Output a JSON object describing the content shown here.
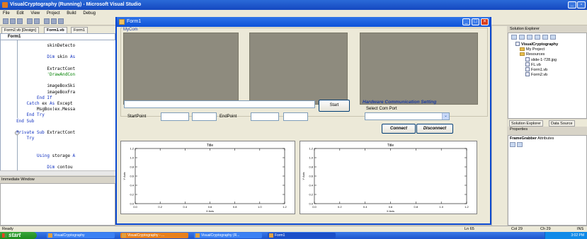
{
  "vs": {
    "title": "VisualCryptography (Running) - Microsoft Visual Studio",
    "menu": [
      "File",
      "Edit",
      "View",
      "Project",
      "Build",
      "Debug"
    ],
    "doc_tabs": [
      "Form2.vb [Design]",
      "Form1.vb",
      "Form1"
    ],
    "code_header": "Form1",
    "code_lines": [
      {
        "indent": "                 ",
        "parts": [
          {
            "t": "skinDetecto",
            "c": ""
          }
        ]
      },
      {
        "indent": "",
        "parts": [
          {
            "t": "",
            "c": ""
          }
        ]
      },
      {
        "indent": "                 ",
        "parts": [
          {
            "t": "Dim",
            "c": "kw"
          },
          {
            "t": " skin ",
            "c": ""
          },
          {
            "t": "As",
            "c": "kw"
          }
        ]
      },
      {
        "indent": "",
        "parts": [
          {
            "t": "",
            "c": ""
          }
        ]
      },
      {
        "indent": "                 ",
        "parts": [
          {
            "t": "ExtractCont",
            "c": ""
          }
        ]
      },
      {
        "indent": "                 ",
        "parts": [
          {
            "t": "'DrawAndCon",
            "c": "cm"
          }
        ]
      },
      {
        "indent": "",
        "parts": [
          {
            "t": "",
            "c": ""
          }
        ]
      },
      {
        "indent": "                 ",
        "parts": [
          {
            "t": "imageBoxSki",
            "c": ""
          }
        ]
      },
      {
        "indent": "                 ",
        "parts": [
          {
            "t": "imageBoxFra",
            "c": ""
          }
        ]
      },
      {
        "indent": "             ",
        "parts": [
          {
            "t": "End If",
            "c": "kw"
          }
        ]
      },
      {
        "indent": "         ",
        "parts": [
          {
            "t": "Catch",
            "c": "kw"
          },
          {
            "t": " ex ",
            "c": ""
          },
          {
            "t": "As",
            "c": "kw"
          },
          {
            "t": " Except",
            "c": ""
          }
        ]
      },
      {
        "indent": "             ",
        "parts": [
          {
            "t": "MsgBox(ex.Messa",
            "c": ""
          }
        ]
      },
      {
        "indent": "         ",
        "parts": [
          {
            "t": "End Try",
            "c": "kw"
          }
        ]
      },
      {
        "indent": "     ",
        "parts": [
          {
            "t": "End Sub",
            "c": "kw"
          }
        ]
      },
      {
        "indent": "",
        "parts": [
          {
            "t": "",
            "c": ""
          }
        ]
      },
      {
        "indent": "     ",
        "parts": [
          {
            "t": "Private Sub",
            "c": "kw"
          },
          {
            "t": " ExtractCont",
            "c": ""
          }
        ]
      },
      {
        "indent": "         ",
        "parts": [
          {
            "t": "Try",
            "c": "kw"
          }
        ]
      },
      {
        "indent": "",
        "parts": [
          {
            "t": "",
            "c": ""
          }
        ]
      },
      {
        "indent": "",
        "parts": [
          {
            "t": "",
            "c": ""
          }
        ]
      },
      {
        "indent": "             ",
        "parts": [
          {
            "t": "Using",
            "c": "kw"
          },
          {
            "t": " storage ",
            "c": ""
          },
          {
            "t": "A",
            "c": "kw"
          }
        ]
      },
      {
        "indent": "",
        "parts": [
          {
            "t": "",
            "c": ""
          }
        ]
      },
      {
        "indent": "                 ",
        "parts": [
          {
            "t": "Dim",
            "c": "kw"
          },
          {
            "t": " contou",
            "c": ""
          }
        ]
      }
    ],
    "immediate_window_title": "Immediate Window",
    "solution_explorer": {
      "title": "Solution Explorer",
      "items": [
        {
          "label": "VisualCryptography",
          "bold": true,
          "level": 1,
          "icon": "project-icon"
        },
        {
          "label": "My Project",
          "level": 2,
          "icon": "folder-icon"
        },
        {
          "label": "Resources",
          "level": 2,
          "icon": "folder-icon"
        },
        {
          "label": "slide-1-728.jpg",
          "level": 3,
          "icon": "image-file-icon"
        },
        {
          "label": "FL.vb",
          "level": 3,
          "icon": "file-icon"
        },
        {
          "label": "Form1.vb",
          "level": 3,
          "icon": "file-icon"
        },
        {
          "label": "Form2.vb",
          "level": 3,
          "icon": "file-icon"
        }
      ],
      "tabs": [
        "Solution Explorer",
        "Data Source"
      ]
    },
    "properties": {
      "title": "Properties",
      "object": "FrameGrabber",
      "object_suffix": "Attributes"
    },
    "status": {
      "ready": "Ready",
      "ln": "Ln 65",
      "col": "Col 29",
      "ch": "Ch 29",
      "ins": "INS"
    }
  },
  "taskbar": {
    "start": "start",
    "buttons": [
      "VisualCryptography",
      "VisualCryptography - ...",
      "VisualCryptography (R...",
      "Form1"
    ],
    "clock": "3:02 PM"
  },
  "form": {
    "title": "Form1",
    "group_label": "MyCom",
    "start_button": "Start",
    "start_point_label": "StartPoint",
    "end_point_label": "EndPoint",
    "hw_title": "Hardware Communication Setting",
    "select_com_label": "Select Com Port",
    "connect_button": "Connect",
    "disconnect_button": "Disconnect",
    "combo_value": ""
  },
  "chart_data": [
    {
      "type": "line",
      "title": "Title",
      "xlabel": "X Axis",
      "ylabel": "Y Axis",
      "xlim": [
        0.0,
        1.2
      ],
      "ylim": [
        0.0,
        1.2
      ],
      "xticks": [
        "0.0",
        "0.2",
        "0.4",
        "0.6",
        "0.8",
        "1.0",
        "1.2"
      ],
      "yticks": [
        "0.0",
        "0.2",
        "0.4",
        "0.6",
        "0.8",
        "1.0",
        "1.2"
      ],
      "series": []
    },
    {
      "type": "line",
      "title": "Title",
      "xlabel": "X Axis",
      "ylabel": "Y Axis",
      "xlim": [
        0.0,
        1.2
      ],
      "ylim": [
        0.0,
        1.2
      ],
      "xticks": [
        "0.0",
        "0.2",
        "0.4",
        "0.6",
        "0.8",
        "1.0",
        "1.2"
      ],
      "yticks": [
        "0.0",
        "0.2",
        "0.4",
        "0.6",
        "0.8",
        "1.0",
        "1.2"
      ],
      "series": []
    }
  ]
}
